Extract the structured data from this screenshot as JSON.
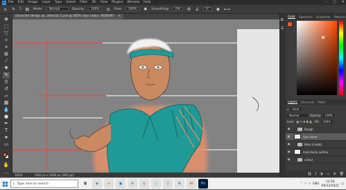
{
  "app": {
    "logo": "Ps"
  },
  "menu": [
    "File",
    "Edit",
    "Image",
    "Layer",
    "Type",
    "Select",
    "Filter",
    "3D",
    "View",
    "Plugins",
    "Window",
    "Help"
  ],
  "options": {
    "mode_label": "Mode:",
    "mode_value": "Normal",
    "opacity_label": "Opacity:",
    "opacity_value": "100%",
    "flow_label": "Flow:",
    "flow_value": "100%",
    "smoothing_label": "Smoothing:",
    "smoothing_value": "0%",
    "angle_value": "0°",
    "brush_size": "5"
  },
  "document": {
    "tab_title": "character design uk, attempt 1.psd @ 300% (eye colour, RGB/8#)",
    "close": "×"
  },
  "status": {
    "zoom": "300%",
    "doc_info": "2000 px x 2000 px (300 ppi)"
  },
  "color_panel": {
    "tabs": [
      "Color",
      "Swatches",
      "Gradients",
      "Patterns"
    ],
    "fg": "#e85a2a",
    "bg": "#ffffff"
  },
  "layers_panel": {
    "tabs": [
      "Layers",
      "Channels",
      "Paths"
    ],
    "filter_label": "Kind",
    "blend_mode": "Normal",
    "opacity_label": "Opacity:",
    "opacity_value": "100%",
    "lock_label": "Lock:",
    "fill_label": "Fill:",
    "fill_value": "100%",
    "layers": [
      {
        "name": "Rough",
        "type": "group",
        "selected": false
      },
      {
        "name": "eye colour",
        "type": "layer",
        "selected": true
      },
      {
        "name": "Main (credit)",
        "type": "group",
        "selected": false
      },
      {
        "name": "main body outline",
        "type": "layer",
        "selected": false
      },
      {
        "name": "colour",
        "type": "group",
        "selected": false
      }
    ]
  },
  "taskbar": {
    "search_placeholder": "Type here to search",
    "time": "12:56",
    "date": "09/12/2021",
    "lang": "ENG"
  },
  "icons": {
    "search": "search-icon",
    "eye": "eye-icon",
    "folder": "folder-icon"
  }
}
